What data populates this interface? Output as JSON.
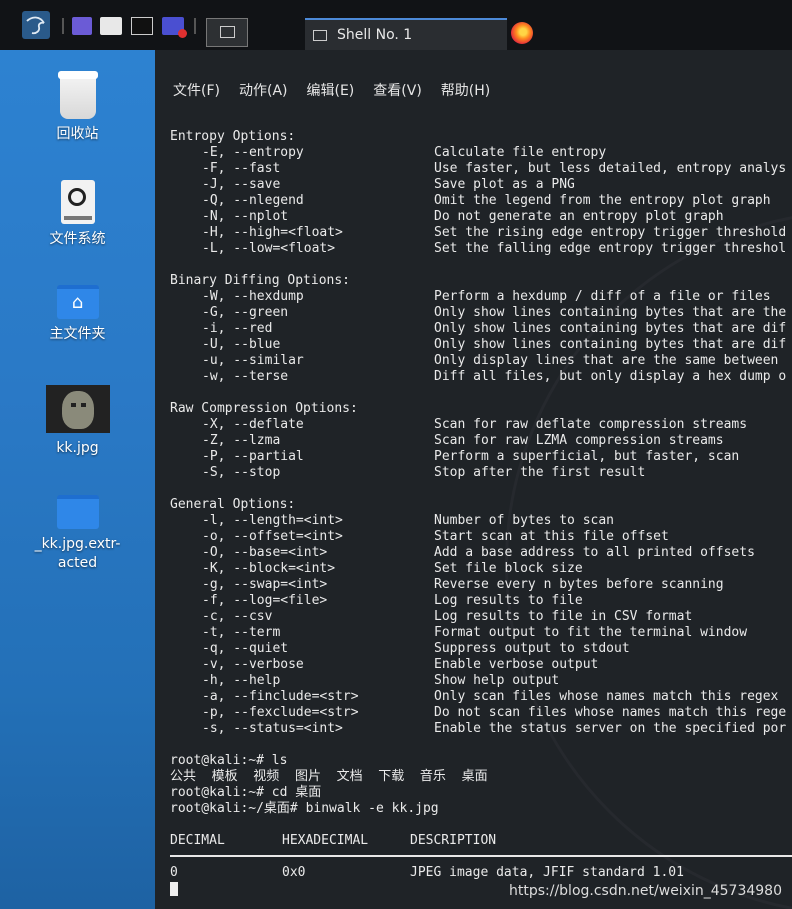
{
  "taskbar": {
    "tab_title": "Shell No. 1"
  },
  "desktop": {
    "icons": [
      {
        "label": "回收站"
      },
      {
        "label": "文件系统"
      },
      {
        "label": "主文件夹"
      },
      {
        "label": "kk.jpg"
      },
      {
        "label": "_kk.jpg.extr-acted"
      }
    ]
  },
  "terminal": {
    "menu": [
      "文件(F)",
      "动作(A)",
      "编辑(E)",
      "查看(V)",
      "帮助(H)"
    ],
    "sections": [
      {
        "header": "Entropy Options:",
        "options": [
          {
            "flag": "-E, --entropy",
            "desc": "Calculate file entropy"
          },
          {
            "flag": "-F, --fast",
            "desc": "Use faster, but less detailed, entropy analys"
          },
          {
            "flag": "-J, --save",
            "desc": "Save plot as a PNG"
          },
          {
            "flag": "-Q, --nlegend",
            "desc": "Omit the legend from the entropy plot graph"
          },
          {
            "flag": "-N, --nplot",
            "desc": "Do not generate an entropy plot graph"
          },
          {
            "flag": "-H, --high=<float>",
            "desc": "Set the rising edge entropy trigger threshold"
          },
          {
            "flag": "-L, --low=<float>",
            "desc": "Set the falling edge entropy trigger threshol"
          }
        ]
      },
      {
        "header": "Binary Diffing Options:",
        "options": [
          {
            "flag": "-W, --hexdump",
            "desc": "Perform a hexdump / diff of a file or files"
          },
          {
            "flag": "-G, --green",
            "desc": "Only show lines containing bytes that are the"
          },
          {
            "flag": "-i, --red",
            "desc": "Only show lines containing bytes that are dif"
          },
          {
            "flag": "-U, --blue",
            "desc": "Only show lines containing bytes that are dif"
          },
          {
            "flag": "-u, --similar",
            "desc": "Only display lines that are the same between"
          },
          {
            "flag": "-w, --terse",
            "desc": "Diff all files, but only display a hex dump o"
          }
        ]
      },
      {
        "header": "Raw Compression Options:",
        "options": [
          {
            "flag": "-X, --deflate",
            "desc": "Scan for raw deflate compression streams"
          },
          {
            "flag": "-Z, --lzma",
            "desc": "Scan for raw LZMA compression streams"
          },
          {
            "flag": "-P, --partial",
            "desc": "Perform a superficial, but faster, scan"
          },
          {
            "flag": "-S, --stop",
            "desc": "Stop after the first result"
          }
        ]
      },
      {
        "header": "General Options:",
        "options": [
          {
            "flag": "-l, --length=<int>",
            "desc": "Number of bytes to scan"
          },
          {
            "flag": "-o, --offset=<int>",
            "desc": "Start scan at this file offset"
          },
          {
            "flag": "-O, --base=<int>",
            "desc": "Add a base address to all printed offsets"
          },
          {
            "flag": "-K, --block=<int>",
            "desc": "Set file block size"
          },
          {
            "flag": "-g, --swap=<int>",
            "desc": "Reverse every n bytes before scanning"
          },
          {
            "flag": "-f, --log=<file>",
            "desc": "Log results to file"
          },
          {
            "flag": "-c, --csv",
            "desc": "Log results to file in CSV format"
          },
          {
            "flag": "-t, --term",
            "desc": "Format output to fit the terminal window"
          },
          {
            "flag": "-q, --quiet",
            "desc": "Suppress output to stdout"
          },
          {
            "flag": "-v, --verbose",
            "desc": "Enable verbose output"
          },
          {
            "flag": "-h, --help",
            "desc": "Show help output"
          },
          {
            "flag": "-a, --finclude=<str>",
            "desc": "Only scan files whose names match this regex"
          },
          {
            "flag": "-p, --fexclude=<str>",
            "desc": "Do not scan files whose names match this rege"
          },
          {
            "flag": "-s, --status=<int>",
            "desc": "Enable the status server on the specified por"
          }
        ]
      }
    ],
    "session": [
      "root@kali:~# ls",
      "公共  模板  视频  图片  文档  下载  音乐  桌面",
      "root@kali:~# cd 桌面",
      "root@kali:~/桌面# binwalk -e kk.jpg"
    ],
    "result_headers": [
      "DECIMAL",
      "HEXADECIMAL",
      "DESCRIPTION"
    ],
    "result_rows": [
      [
        "0",
        "0x0",
        "JPEG image data, JFIF standard 1.01"
      ]
    ]
  },
  "watermark": "https://blog.csdn.net/weixin_45734980"
}
